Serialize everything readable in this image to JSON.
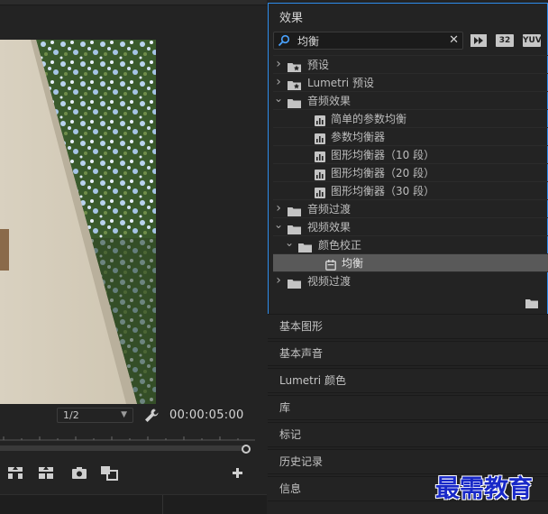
{
  "monitor": {
    "fraction": "1/2",
    "timecode": "00:00:05:00"
  },
  "effects": {
    "title": "效果",
    "search_value": "均衡",
    "tool_labels": {
      "bit32": "32",
      "yuv": "YUV"
    },
    "tree": [
      {
        "label": "预设",
        "type": "preset-folder",
        "depth": 0,
        "expanded": false
      },
      {
        "label": "Lumetri 预设",
        "type": "preset-folder",
        "depth": 0,
        "expanded": false
      },
      {
        "label": "音频效果",
        "type": "folder",
        "depth": 0,
        "expanded": true
      },
      {
        "label": "简单的参数均衡",
        "type": "audio-effect",
        "depth": 1
      },
      {
        "label": "参数均衡器",
        "type": "audio-effect",
        "depth": 1
      },
      {
        "label": "图形均衡器（10 段）",
        "type": "audio-effect",
        "depth": 1
      },
      {
        "label": "图形均衡器（20 段）",
        "type": "audio-effect",
        "depth": 1
      },
      {
        "label": "图形均衡器（30 段）",
        "type": "audio-effect",
        "depth": 1
      },
      {
        "label": "音频过渡",
        "type": "folder",
        "depth": 0,
        "expanded": false
      },
      {
        "label": "视频效果",
        "type": "folder",
        "depth": 0,
        "expanded": true
      },
      {
        "label": "颜色校正",
        "type": "folder",
        "depth": 1,
        "expanded": true
      },
      {
        "label": "均衡",
        "type": "video-effect",
        "depth": 2,
        "selected": true
      },
      {
        "label": "视频过渡",
        "type": "folder",
        "depth": 0,
        "expanded": false
      }
    ]
  },
  "panels": [
    {
      "label": "基本图形",
      "id": "essential-graphics"
    },
    {
      "label": "基本声音",
      "id": "essential-sound"
    },
    {
      "label": "Lumetri 颜色",
      "id": "lumetri-color"
    },
    {
      "label": "库",
      "id": "libraries"
    },
    {
      "label": "标记",
      "id": "markers"
    },
    {
      "label": "历史记录",
      "id": "history"
    },
    {
      "label": "信息",
      "id": "info"
    }
  ],
  "watermark": "最需教育",
  "colors": {
    "accent": "#2d8ceb",
    "panel_bg": "#232323",
    "selected_row": "#595959",
    "watermark": "#1828c8"
  }
}
